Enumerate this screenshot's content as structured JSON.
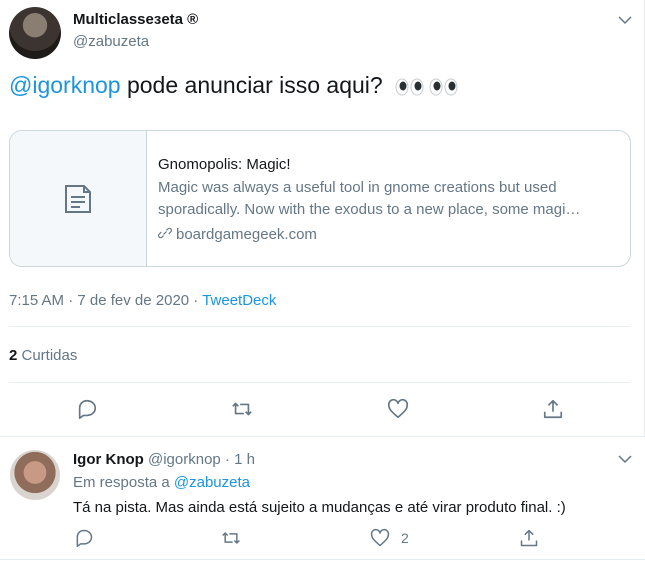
{
  "tweet": {
    "author_name": "Multiclasseзeta ®",
    "author_handle": "@zabuzeta",
    "mention": "@igorknop",
    "text": " pode anunciar isso aqui?",
    "emoji": "eyes-emoji",
    "card": {
      "title": "Gnomopolis: Magic!",
      "description": "Magic was always a useful tool in gnome creations but used sporadically. Now with the exodus to a new place, some magi…",
      "domain": "boardgamegeek.com",
      "thumb_icon": "document-icon"
    },
    "time": "7:15 AM · 7 de fev de 2020 · ",
    "source": "TweetDeck",
    "likes_count": "2",
    "likes_label": " Curtidas",
    "actions": [
      "reply-icon",
      "retweet-icon",
      "like-icon",
      "share-icon"
    ]
  },
  "reply": {
    "author_name": "Igor Knop",
    "author_handle": "@igorknop · 1 h",
    "reply_prefix": "Em resposta a ",
    "reply_mention": "@zabuzeta",
    "text": "Tá na pista. Mas ainda está sujeito a mudanças e até virar produto final. :)",
    "like_count": "2"
  },
  "colors": {
    "accent": "#1b95e0",
    "text": "#14171a",
    "muted": "#657786",
    "border": "#ccd6dd"
  }
}
